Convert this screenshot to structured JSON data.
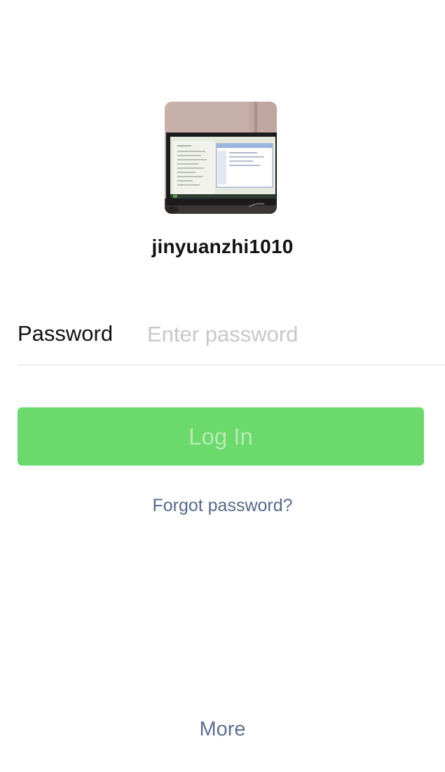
{
  "profile": {
    "username": "jinyuanzhi1010",
    "avatar_icon": "avatar-photo-monitor"
  },
  "password_field": {
    "label": "Password",
    "placeholder": "Enter password",
    "value": ""
  },
  "actions": {
    "login_label": "Log In",
    "login_color": "#6bd96c",
    "forgot_label": "Forgot password?",
    "more_label": "More"
  }
}
